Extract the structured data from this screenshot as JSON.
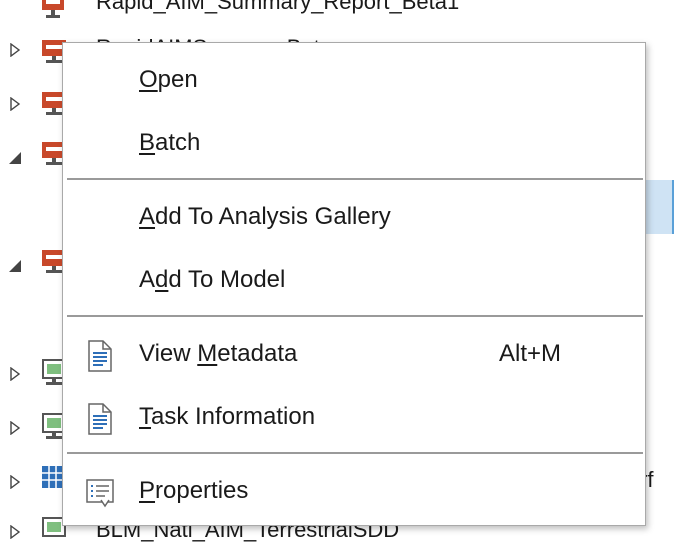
{
  "tree": {
    "rows": [
      {
        "label": "Rapid_AIM_Summary_Report_Beta1",
        "expander": "none",
        "icon": "toolbox-icon"
      },
      {
        "label": "RapidAIMSummaryBeta",
        "expander": "collapsed",
        "icon": "toolbox-icon"
      },
      {
        "label": "",
        "expander": "collapsed",
        "icon": "toolbox-icon"
      },
      {
        "label": "",
        "expander": "expanded",
        "icon": "toolbox-icon"
      },
      {
        "label": "",
        "expander": "expanded",
        "icon": "toolbox-icon"
      },
      {
        "label": "",
        "expander": "collapsed",
        "icon": "map-icon"
      },
      {
        "label": "",
        "expander": "collapsed",
        "icon": "map-icon"
      },
      {
        "label": "",
        "expander": "collapsed",
        "icon": "geodatabase-icon"
      },
      {
        "label": "BLM_Natl_AIM_TerrestrialSDD",
        "expander": "collapsed",
        "icon": "map-icon"
      }
    ],
    "trailing_text": "rf"
  },
  "menu": {
    "items": [
      {
        "pre": "",
        "ul": "O",
        "post": "pen",
        "shortcut": "",
        "icon": ""
      },
      {
        "pre": "",
        "ul": "B",
        "post": "atch",
        "shortcut": "",
        "icon": ""
      },
      {
        "pre": "",
        "ul": "A",
        "post": "dd To Analysis Gallery",
        "shortcut": "",
        "icon": ""
      },
      {
        "pre": "A",
        "ul": "d",
        "post": "d To Model",
        "shortcut": "",
        "icon": ""
      },
      {
        "pre": "View ",
        "ul": "M",
        "post": "etadata",
        "shortcut": "Alt+M",
        "icon": "metadata-icon"
      },
      {
        "pre": "",
        "ul": "T",
        "post": "ask Information",
        "shortcut": "",
        "icon": "task-info-icon"
      },
      {
        "pre": "",
        "ul": "P",
        "post": "roperties",
        "shortcut": "",
        "icon": "properties-icon"
      }
    ]
  },
  "colors": {
    "selection": "#cfe3f4",
    "toolbox_red": "#c8482a",
    "icon_blue": "#2e6fb8",
    "separator": "#9a9a9a"
  }
}
